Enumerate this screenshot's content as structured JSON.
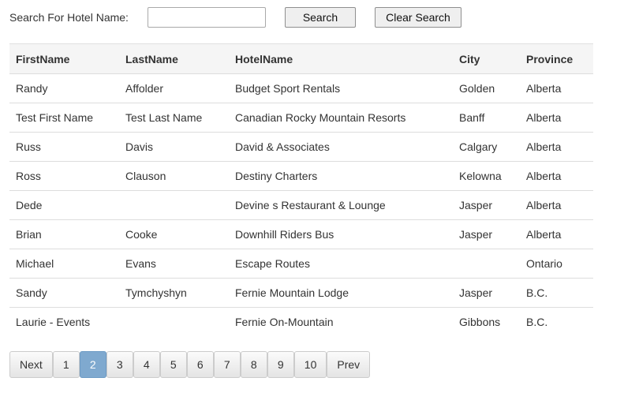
{
  "search": {
    "label": "Search For Hotel Name:",
    "input_value": "",
    "search_button": "Search",
    "clear_button": "Clear Search"
  },
  "table": {
    "headers": [
      "FirstName",
      "LastName",
      "HotelName",
      "City",
      "Province"
    ],
    "rows": [
      [
        "Randy",
        "Affolder",
        "Budget Sport Rentals",
        "Golden",
        "Alberta"
      ],
      [
        "Test First Name",
        "Test Last Name",
        "Canadian Rocky Mountain Resorts",
        "Banff",
        "Alberta"
      ],
      [
        "Russ",
        "Davis",
        "David & Associates",
        "Calgary",
        "Alberta"
      ],
      [
        "Ross",
        "Clauson",
        "Destiny Charters",
        "Kelowna",
        "Alberta"
      ],
      [
        "Dede",
        "",
        "Devine s Restaurant & Lounge",
        "Jasper",
        "Alberta"
      ],
      [
        "Brian",
        "Cooke",
        "Downhill Riders Bus",
        "Jasper",
        "Alberta"
      ],
      [
        "Michael",
        "Evans",
        "Escape Routes",
        "",
        "Ontario"
      ],
      [
        "Sandy",
        "Tymchyshyn",
        "Fernie Mountain Lodge",
        "Jasper",
        "B.C."
      ],
      [
        "Laurie - Events",
        "",
        "Fernie On-Mountain",
        "Gibbons",
        "B.C."
      ]
    ]
  },
  "pager": {
    "buttons": [
      "Next",
      "1",
      "2",
      "3",
      "4",
      "5",
      "6",
      "7",
      "8",
      "9",
      "10",
      "Prev"
    ],
    "active_page": "2",
    "active_color": "#7fa9cf"
  }
}
